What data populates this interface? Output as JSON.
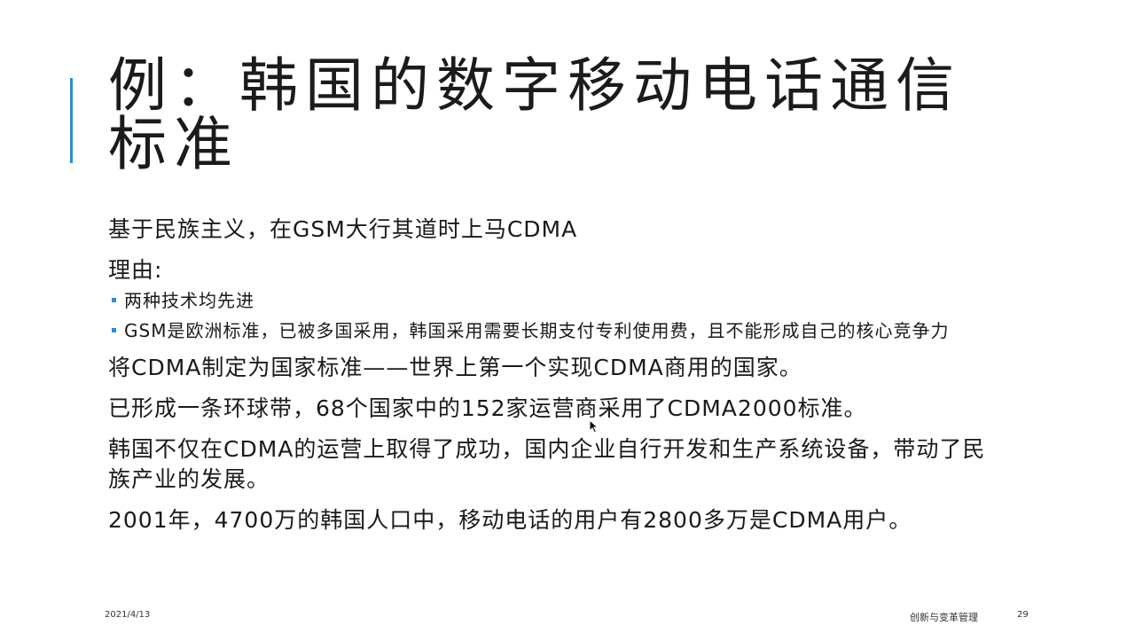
{
  "slide": {
    "title": "例：韩国的数字移动电话通信标准",
    "paragraphs": {
      "p1": "基于民族主义，在GSM大行其道时上马CDMA",
      "p2": "理由:",
      "p3": "将CDMA制定为国家标准——世界上第一个实现CDMA商用的国家。",
      "p4": "已形成一条环球带，68个国家中的152家运营商采用了CDMA2000标准。",
      "p5": "韩国不仅在CDMA的运营上取得了成功，国内企业自行开发和生产系统设备，带动了民族产业的发展。",
      "p6": "2001年，4700万的韩国人口中，移动电话的用户有2800多万是CDMA用户。"
    },
    "bullets": [
      "两种技术均先进",
      "GSM是欧洲标准，已被多国采用，韩国采用需要长期支付专利使用费，且不能形成自己的核心竞争力"
    ]
  },
  "footer": {
    "date": "2021/4/13",
    "course": "创新与变革管理",
    "page": "29"
  },
  "colors": {
    "accent": "#2e8bd0",
    "text": "#1a1a1a"
  },
  "icons": {
    "cursor": "mouse-pointer-icon"
  }
}
